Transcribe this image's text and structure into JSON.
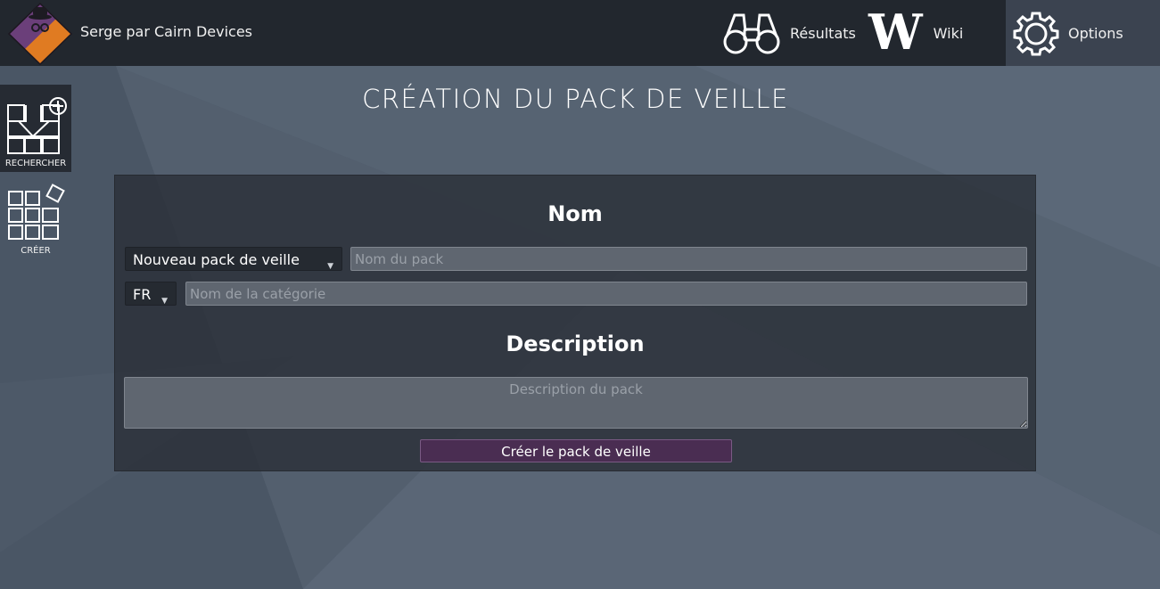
{
  "header": {
    "brand": "Serge par Cairn Devices",
    "nav": {
      "results_label": "Résultats",
      "wiki_label": "Wiki",
      "wiki_glyph": "W",
      "options_label": "Options"
    }
  },
  "sidebar": {
    "items": [
      {
        "label": "RECHERCHER",
        "icon": "search-grid-plus-icon"
      },
      {
        "label": "CRÉER",
        "icon": "create-grid-icon"
      }
    ]
  },
  "page": {
    "title": "CRÉATION DU PACK DE VEILLE"
  },
  "form": {
    "name_section_title": "Nom",
    "pack_select_value": "Nouveau pack de veille",
    "pack_name_placeholder": "Nom du pack",
    "language_select_value": "FR",
    "category_placeholder": "Nom de la catégorie",
    "description_section_title": "Description",
    "description_placeholder": "Description du pack",
    "submit_label": "Créer le pack de veille"
  },
  "colors": {
    "header_bg": "#22272e",
    "options_bg": "#3b4350",
    "page_bg": "#4f5b6a",
    "card_bg": "#2b3038",
    "submit_bg": "#4a2d52",
    "logo_purple": "#6b3f7a",
    "logo_orange": "#e07b22"
  }
}
